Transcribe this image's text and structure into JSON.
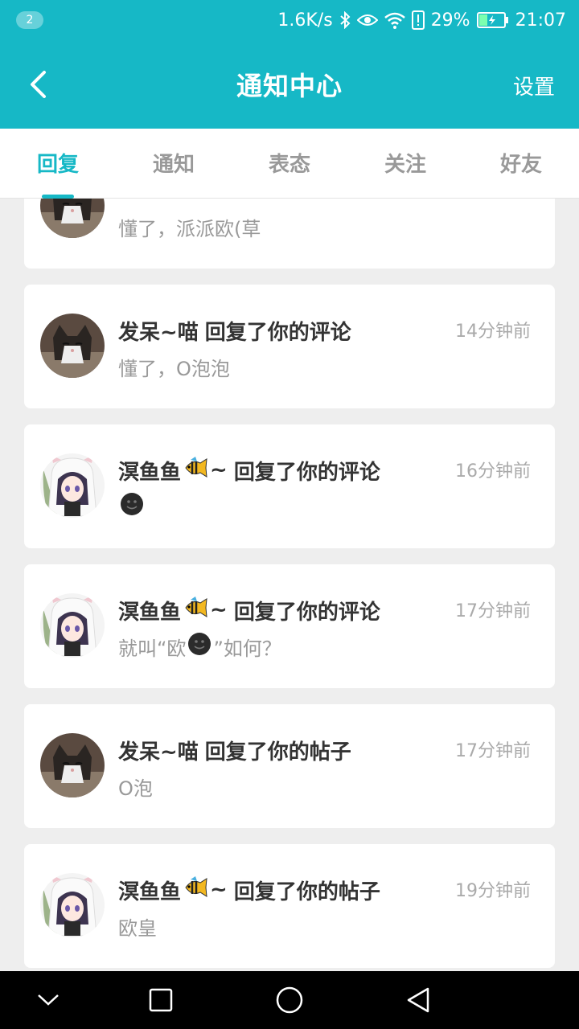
{
  "status_bar": {
    "notification_count": "2",
    "net_speed": "1.6K/s",
    "battery": "29%",
    "time": "21:07",
    "icons": [
      "bluetooth-icon",
      "eye-icon",
      "wifi-icon",
      "alert-icon",
      "battery-charging-icon"
    ]
  },
  "header": {
    "title": "通知中心",
    "settings_label": "设置",
    "back_icon": "back-arrow-icon"
  },
  "tabs": [
    {
      "label": "回复",
      "active": true
    },
    {
      "label": "通知",
      "active": false
    },
    {
      "label": "表态",
      "active": false
    },
    {
      "label": "关注",
      "active": false
    },
    {
      "label": "好友",
      "active": false
    }
  ],
  "notifications": [
    {
      "user": "",
      "action": "",
      "time": "",
      "content": "懂了，派派欧(草",
      "avatar": "cat"
    },
    {
      "user": "发呆~喵",
      "action": "回复了你的评论",
      "time": "14分钟前",
      "content": "懂了，O泡泡",
      "avatar": "cat"
    },
    {
      "user_prefix": "溟鱼鱼",
      "user_suffix": "~",
      "action": "回复了你的评论",
      "time": "16分钟前",
      "content": "",
      "avatar": "anime-girl"
    },
    {
      "user_prefix": "溟鱼鱼",
      "user_suffix": "~",
      "action": "回复了你的评论",
      "time": "17分钟前",
      "content_before": "就叫“欧",
      "content_after": "”如何？",
      "avatar": "anime-girl"
    },
    {
      "user": "发呆~喵",
      "action": "回复了你的帖子",
      "time": "17分钟前",
      "content": "O泡",
      "avatar": "cat"
    },
    {
      "user_prefix": "溟鱼鱼",
      "user_suffix": "~",
      "action": "回复了你的帖子",
      "time": "19分钟前",
      "content": "欧皇",
      "avatar": "anime-girl"
    }
  ],
  "colors": {
    "accent": "#16b8c6",
    "background": "#eeeeee",
    "card": "#ffffff",
    "title_text": "#333333",
    "muted_text": "#999999"
  },
  "nav_bar": {
    "icons": [
      "collapse-icon",
      "recents-icon",
      "home-icon",
      "back-icon"
    ]
  }
}
